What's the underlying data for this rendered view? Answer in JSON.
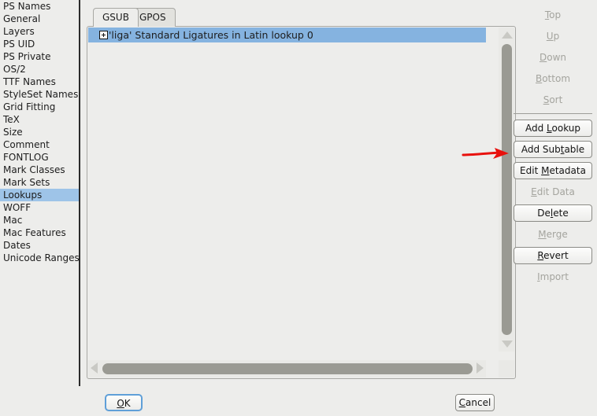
{
  "sidebar": {
    "items": [
      {
        "label": "PS Names",
        "selected": false
      },
      {
        "label": "General",
        "selected": false
      },
      {
        "label": "Layers",
        "selected": false
      },
      {
        "label": "PS UID",
        "selected": false
      },
      {
        "label": "PS Private",
        "selected": false
      },
      {
        "label": "OS/2",
        "selected": false
      },
      {
        "label": "TTF Names",
        "selected": false
      },
      {
        "label": "StyleSet Names",
        "selected": false
      },
      {
        "label": "Grid Fitting",
        "selected": false
      },
      {
        "label": "TeX",
        "selected": false
      },
      {
        "label": "Size",
        "selected": false
      },
      {
        "label": "Comment",
        "selected": false
      },
      {
        "label": "FONTLOG",
        "selected": false
      },
      {
        "label": "Mark Classes",
        "selected": false
      },
      {
        "label": "Mark Sets",
        "selected": false
      },
      {
        "label": "Lookups",
        "selected": true
      },
      {
        "label": "WOFF",
        "selected": false
      },
      {
        "label": "Mac",
        "selected": false
      },
      {
        "label": "Mac Features",
        "selected": false
      },
      {
        "label": "Dates",
        "selected": false
      },
      {
        "label": "Unicode Ranges",
        "selected": false
      }
    ]
  },
  "tabs": [
    {
      "label": "GSUB",
      "active": true
    },
    {
      "label": "GPOS",
      "active": false
    }
  ],
  "lookup_list": {
    "rows": [
      {
        "label": "'liga' Standard Ligatures in Latin lookup 0",
        "selected": true,
        "expander": "plus-icon",
        "expanded": false
      }
    ]
  },
  "scrollbars": {
    "vertical": {
      "up_icon": "triangle-up-icon",
      "down_icon": "triangle-down-icon"
    },
    "horizontal": {
      "left_icon": "triangle-left-icon",
      "right_icon": "triangle-right-icon"
    }
  },
  "tool_buttons": [
    {
      "label": "Top",
      "enabled": false,
      "mnemonic": "T"
    },
    {
      "label": "Up",
      "enabled": false,
      "mnemonic": "U"
    },
    {
      "label": "Down",
      "enabled": false,
      "mnemonic": "D"
    },
    {
      "label": "Bottom",
      "enabled": false,
      "mnemonic": "B"
    },
    {
      "label": "Sort",
      "enabled": false,
      "mnemonic": "S"
    },
    {
      "label": "Add Lookup",
      "enabled": true,
      "mnemonic": "L"
    },
    {
      "label": "Add Subtable",
      "enabled": true,
      "mnemonic": "t"
    },
    {
      "label": "Edit Metadata",
      "enabled": true,
      "mnemonic": "M"
    },
    {
      "label": "Edit Data",
      "enabled": false,
      "mnemonic": "E"
    },
    {
      "label": "Delete",
      "enabled": true,
      "mnemonic": "l"
    },
    {
      "label": "Merge",
      "enabled": false,
      "mnemonic": "M"
    },
    {
      "label": "Revert",
      "enabled": true,
      "mnemonic": "R"
    },
    {
      "label": "Import",
      "enabled": false,
      "mnemonic": "I"
    }
  ],
  "dialog_buttons": {
    "ok": {
      "label": "OK",
      "mnemonic": "O",
      "default": true
    },
    "cancel": {
      "label": "Cancel",
      "mnemonic": "C",
      "default": false
    }
  },
  "annotation": {
    "arrow": "red-arrow-pointing-right",
    "color": "#e8110d",
    "target": "Add Subtable"
  },
  "colors": {
    "background": "#ededeb",
    "selection_blue": "#9ec4e8",
    "row_selection_blue": "#85b3e0",
    "scroll_thumb": "#9a9a93",
    "border": "#a8a8a4",
    "focus_ring": "#5f9fd8",
    "annotation_red": "#e8110d"
  }
}
